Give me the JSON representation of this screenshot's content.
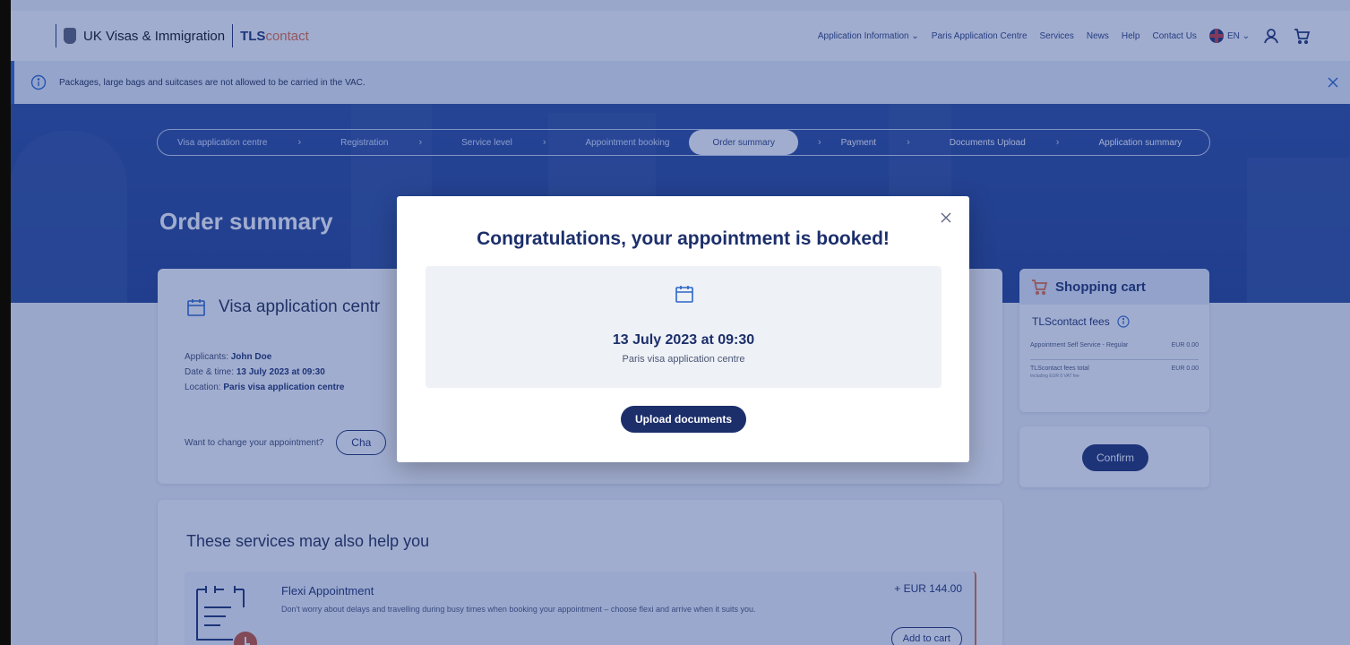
{
  "header": {
    "brand": "UK Visas & Immigration",
    "tls_bold": "TLS",
    "tls_light": "contact",
    "nav": {
      "application_information": "Application Information ⌄",
      "paris_centre": "Paris Application Centre",
      "services": "Services",
      "news": "News",
      "help": "Help",
      "contact_us": "Contact Us"
    },
    "language": "EN ⌄"
  },
  "banner": {
    "message": "Packages, large bags and suitcases are not allowed to be carried in the VAC."
  },
  "stepper": {
    "steps": [
      {
        "label": "Visa application centre"
      },
      {
        "label": "Registration"
      },
      {
        "label": "Service level"
      },
      {
        "label": "Appointment booking"
      },
      {
        "label": "Order summary"
      },
      {
        "label": "Payment"
      },
      {
        "label": "Documents Upload"
      },
      {
        "label": "Application summary"
      }
    ]
  },
  "page": {
    "title": "Order summary"
  },
  "vac_card": {
    "title": "Visa application centr",
    "applicants_label": "Applicants:",
    "applicants_value": "John Doe",
    "datetime_label": "Date & time:",
    "datetime_value": "13 July 2023 at 09:30",
    "location_label": "Location:",
    "location_value": "Paris visa application centre",
    "change_question": "Want to change your appointment?",
    "change_button": "Cha"
  },
  "cart": {
    "title": "Shopping cart",
    "fees_title": "TLScontact fees",
    "line_item_label": "Appointment Self Service - Regular",
    "line_item_value": "EUR 0.00",
    "total_label": "TLScontact fees total",
    "total_value": "EUR 0.00",
    "total_sub": "Including EUR 0 VAT fee",
    "confirm_button": "Confirm"
  },
  "services": {
    "title": "These services may also help you",
    "item": {
      "name": "Flexi Appointment",
      "description": "Don't worry about delays and travelling during busy times when booking your appointment – choose flexi and arrive when it suits you.",
      "price": "+ EUR 144.00",
      "add_button": "Add to cart"
    }
  },
  "modal": {
    "title": "Congratulations, your appointment is booked!",
    "datetime": "13 July 2023 at 09:30",
    "location": "Paris visa application centre",
    "upload_button": "Upload documents"
  }
}
